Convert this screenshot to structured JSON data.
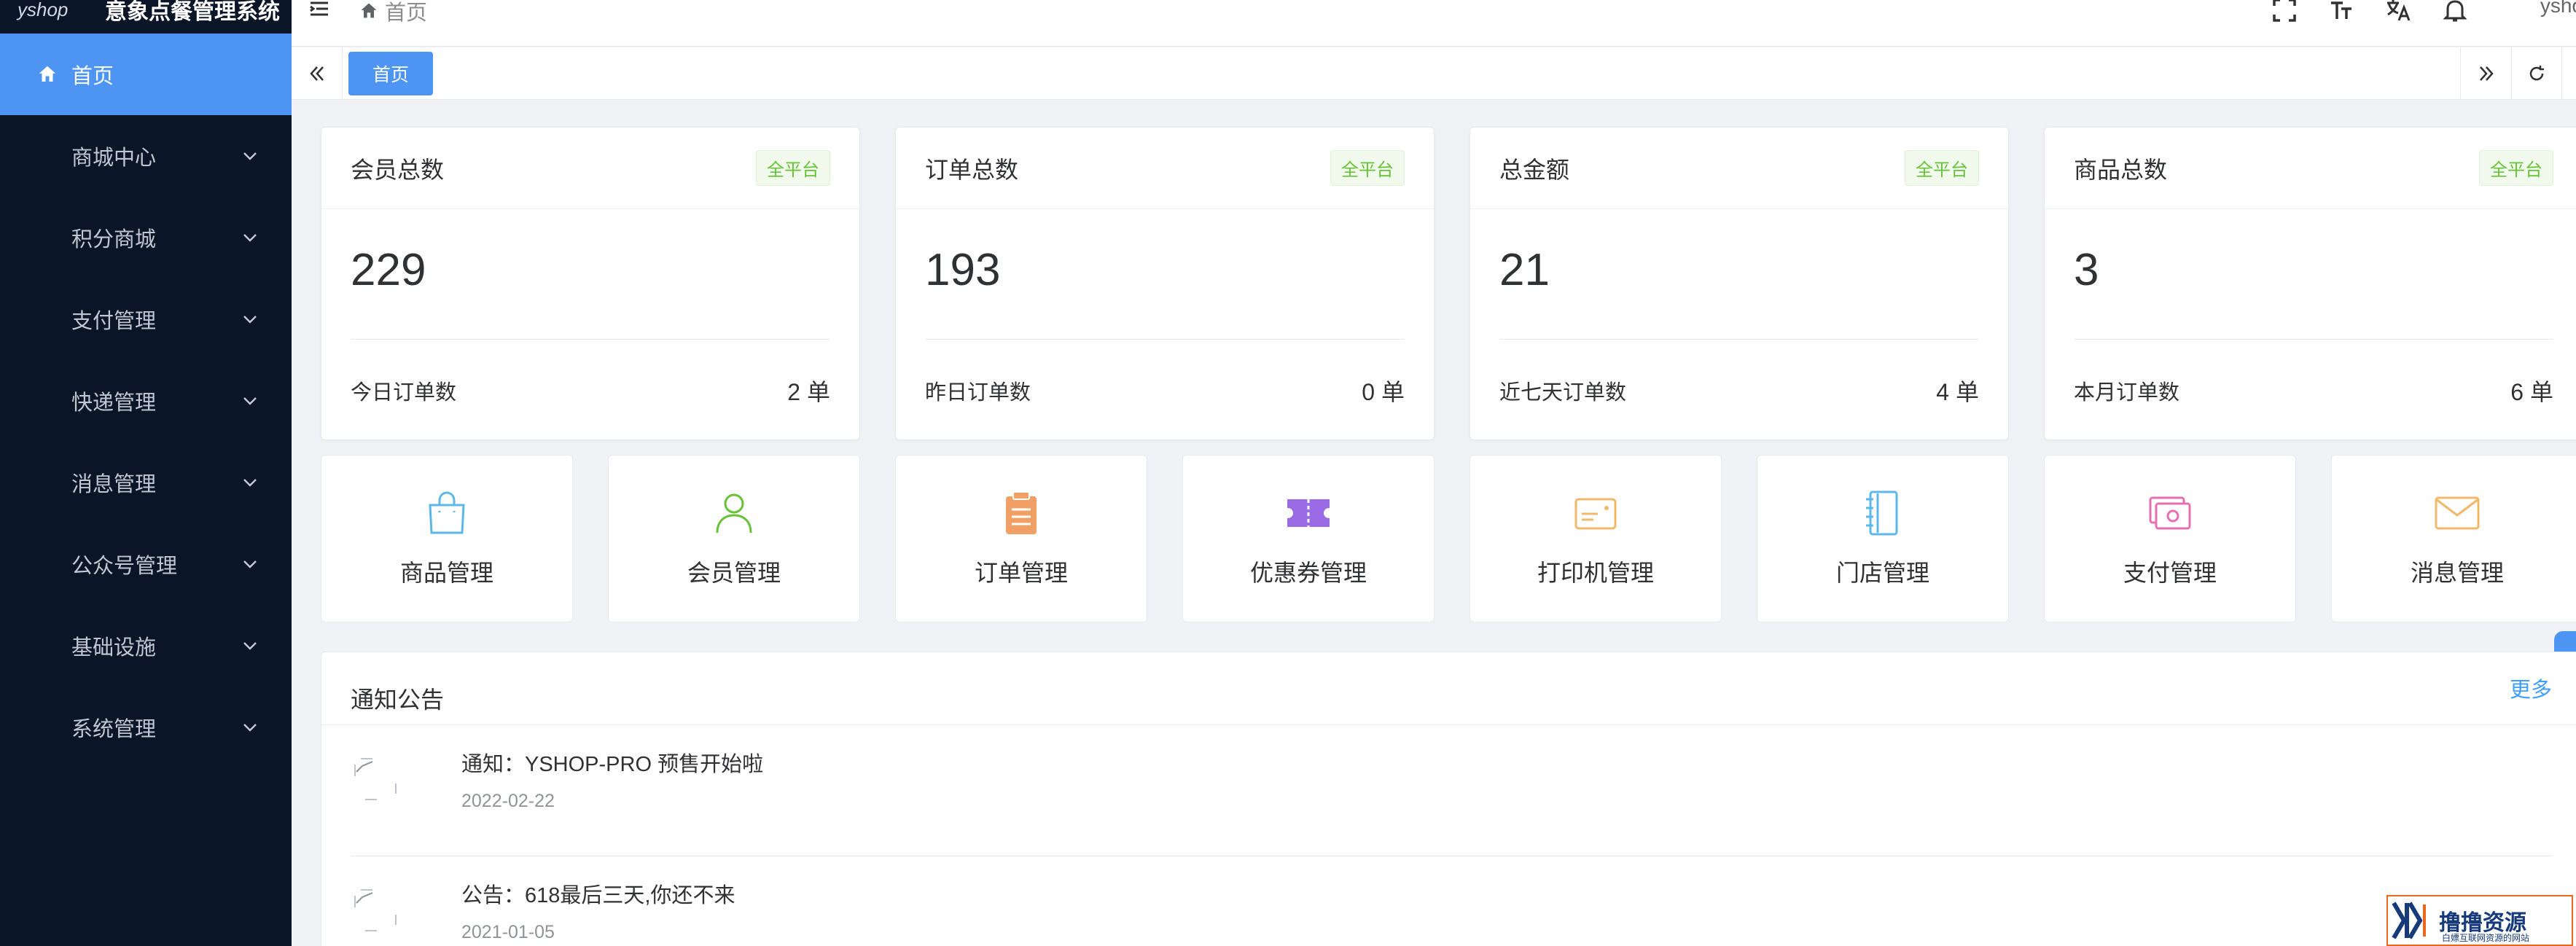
{
  "app": {
    "logo_text": "yshop",
    "title": "意象点餐管理系统",
    "user": "ysho"
  },
  "sidebar": {
    "items": [
      {
        "label": "首页",
        "active": true
      },
      {
        "label": "商城中心"
      },
      {
        "label": "积分商城"
      },
      {
        "label": "支付管理"
      },
      {
        "label": "快递管理"
      },
      {
        "label": "消息管理"
      },
      {
        "label": "公众号管理"
      },
      {
        "label": "基础设施"
      },
      {
        "label": "系统管理"
      }
    ]
  },
  "breadcrumb": {
    "home": "首页"
  },
  "tags": {
    "active": "首页"
  },
  "stats": [
    {
      "title": "会员总数",
      "badge": "全平台",
      "value": "229",
      "foot_label": "今日订单数",
      "foot_value": "2 单"
    },
    {
      "title": "订单总数",
      "badge": "全平台",
      "value": "193",
      "foot_label": "昨日订单数",
      "foot_value": "0 单"
    },
    {
      "title": "总金额",
      "badge": "全平台",
      "value": "21",
      "foot_label": "近七天订单数",
      "foot_value": "4 单"
    },
    {
      "title": "商品总数",
      "badge": "全平台",
      "value": "3",
      "foot_label": "本月订单数",
      "foot_value": "6 单"
    }
  ],
  "tiles": [
    {
      "label": "商品管理",
      "icon": "shopping-bag-icon",
      "color": "#5bb8e9"
    },
    {
      "label": "会员管理",
      "icon": "user-icon",
      "color": "#67c23a"
    },
    {
      "label": "订单管理",
      "icon": "clipboard-icon",
      "color": "#f0a065"
    },
    {
      "label": "优惠券管理",
      "icon": "ticket-icon",
      "color": "#9b6be6"
    },
    {
      "label": "打印机管理",
      "icon": "card-icon",
      "color": "#f0b86a"
    },
    {
      "label": "门店管理",
      "icon": "notebook-icon",
      "color": "#5bb8e9"
    },
    {
      "label": "支付管理",
      "icon": "money-icon",
      "color": "#e66fb0"
    },
    {
      "label": "消息管理",
      "icon": "mail-icon",
      "color": "#f0b86a"
    }
  ],
  "notice": {
    "title": "通知公告",
    "more": "更多",
    "items": [
      {
        "text": "通知：YSHOP-PRO 预售开始啦",
        "date": "2022-02-22"
      },
      {
        "text": "公告：618最后三天,你还不来",
        "date": "2021-01-05"
      }
    ]
  },
  "watermark": {
    "text": "撸撸资源",
    "sub": "白嫖互联网资源的网站"
  },
  "colors": {
    "sidebar_bg": "#0a1628",
    "accent": "#4d94f3",
    "badge_green": "#67c23a",
    "link": "#409eff"
  }
}
